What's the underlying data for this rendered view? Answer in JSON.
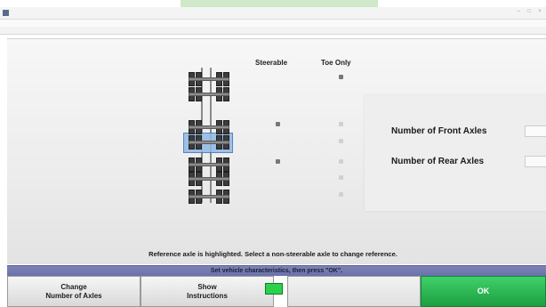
{
  "colors": {
    "highlight": "#8fb8e5",
    "status_bar": "#6a72a8",
    "ok_button": "#1e9e42",
    "indicator": "#2bd14a"
  },
  "window": {
    "title": "",
    "controls": [
      "–",
      "□",
      "×"
    ]
  },
  "menu": {
    "label": ""
  },
  "subbar": {
    "label": ""
  },
  "columns": {
    "steerable": "Steerable",
    "toe_only": "Toe Only"
  },
  "axles": [
    {
      "steerable": null,
      "toe_only": true
    },
    {
      "steerable": null,
      "toe_only": false
    },
    {
      "steerable": true,
      "toe_only": false,
      "highlighted": true
    },
    {
      "steerable": null,
      "toe_only": false,
      "highlighted": true
    },
    {
      "steerable": true,
      "toe_only": false
    },
    {
      "steerable": null,
      "toe_only": false
    },
    {
      "steerable": null,
      "toe_only": false
    }
  ],
  "panel": {
    "front_label": "Number of Front Axles",
    "rear_label": "Number of Rear Axles",
    "front_value": "",
    "rear_value": ""
  },
  "note": "Reference axle is highlighted.  Select a non-steerable axle to change reference.",
  "status": "Set vehicle characteristics, then press \"OK\".",
  "buttons": {
    "change_axles": "Change\nNumber of Axles",
    "show_instructions": "Show\nInstructions",
    "ok": "OK"
  }
}
